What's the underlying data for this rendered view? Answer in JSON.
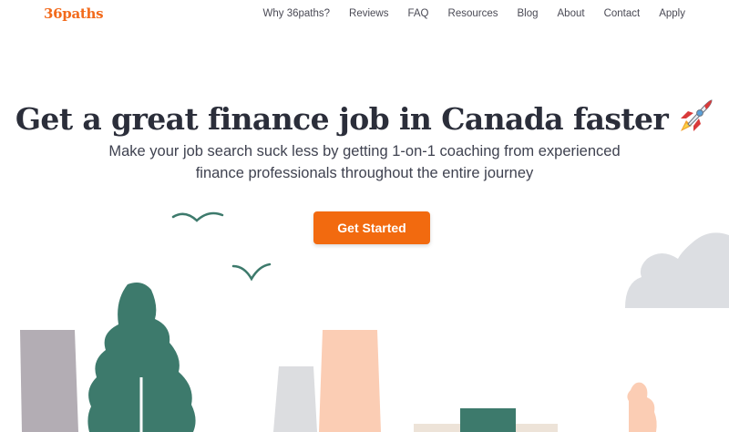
{
  "brand": {
    "logo": "36paths",
    "accent": "#f26a1b"
  },
  "nav": {
    "items": [
      {
        "label": "Why 36paths?"
      },
      {
        "label": "Reviews"
      },
      {
        "label": "FAQ"
      },
      {
        "label": "Resources"
      },
      {
        "label": "Blog"
      },
      {
        "label": "About"
      },
      {
        "label": "Contact"
      },
      {
        "label": "Apply"
      }
    ]
  },
  "hero": {
    "title": "Get a great finance job in Canada faster",
    "title_icon": "rocket-icon",
    "subtitle_line1": "Make your job search suck less by getting 1-on-1 coaching from experienced",
    "subtitle_line2": "finance professionals throughout the entire journey",
    "cta_label": "Get Started",
    "cta_color": "#f26a0f"
  },
  "illustration": {
    "icons": [
      "bird-icon",
      "bird-icon",
      "cloud-icon",
      "tree-icon",
      "building-icon"
    ]
  }
}
